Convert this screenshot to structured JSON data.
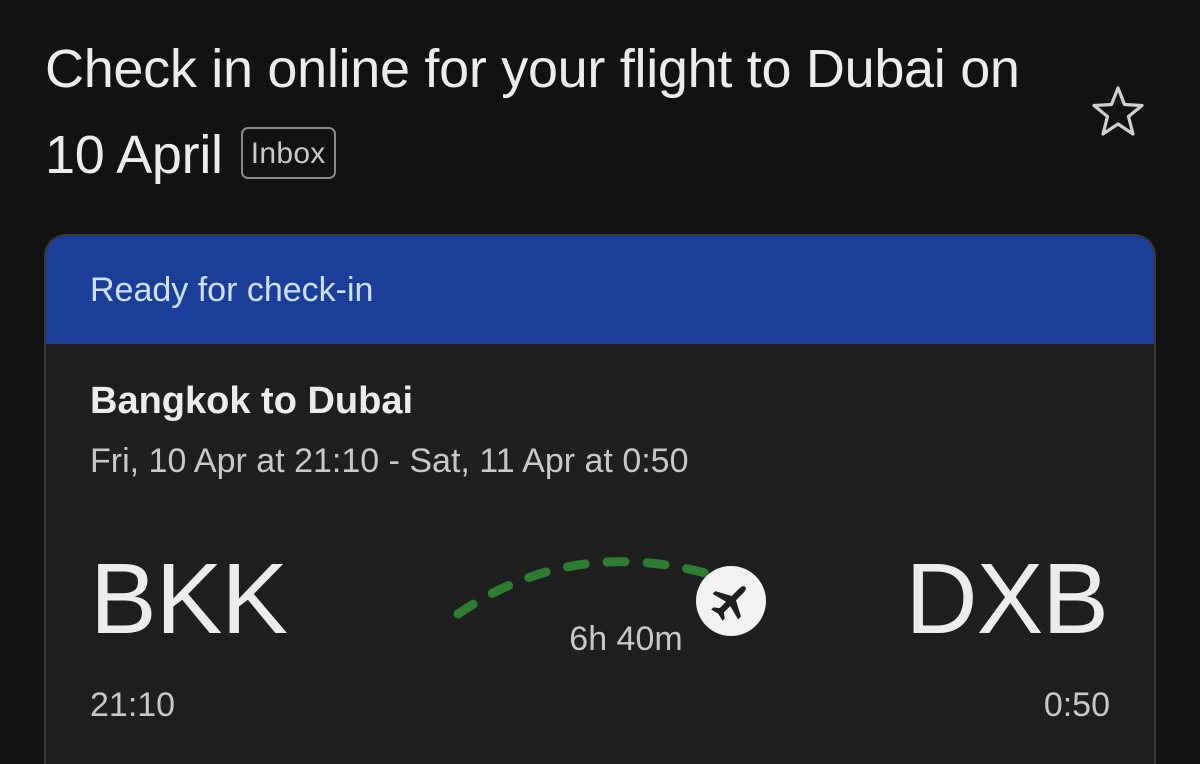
{
  "email": {
    "subject": "Check in online for your flight to Dubai on 10 April",
    "label_badge": "Inbox",
    "star_icon": "star-outline-icon"
  },
  "flight_card": {
    "status": "Ready for check-in",
    "status_color": "#1b3e98",
    "route_title": "Bangkok to Dubai",
    "schedule": "Fri, 10 Apr at 21:10 - Sat, 11 Apr at 0:50",
    "origin": {
      "code": "BKK",
      "time": "21:10"
    },
    "destination": {
      "code": "DXB",
      "time": "0:50"
    },
    "duration": "6h 40m",
    "progress_color": "#2e7d32",
    "plane_icon": "airplane-icon"
  }
}
